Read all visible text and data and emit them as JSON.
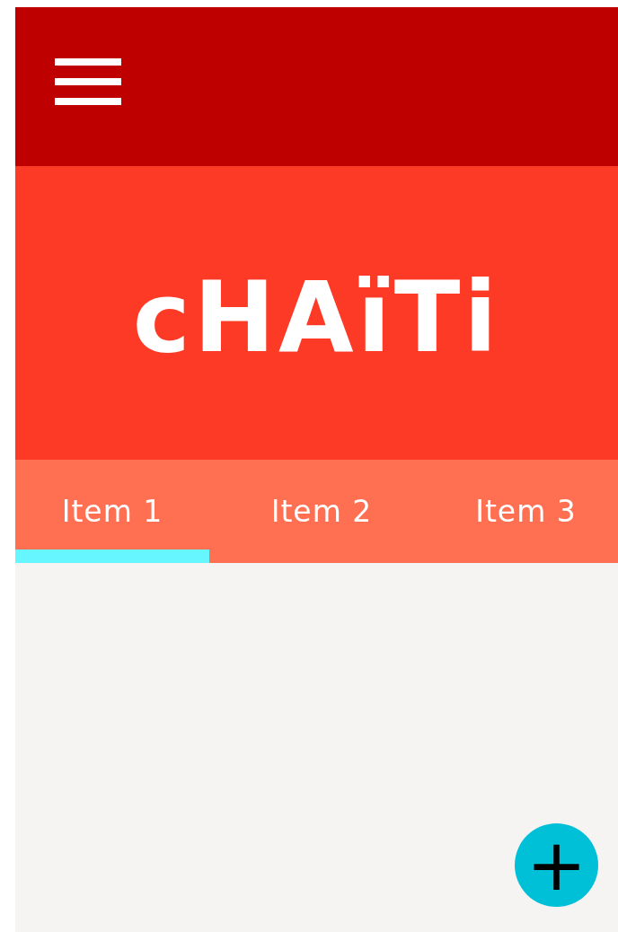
{
  "logo": {
    "text": "cHAïTi"
  },
  "tabs": [
    {
      "label": "Item 1",
      "selected": true
    },
    {
      "label": "Item 2",
      "selected": false
    },
    {
      "label": "Item 3",
      "selected": false
    }
  ],
  "fab": {
    "label": "+"
  }
}
